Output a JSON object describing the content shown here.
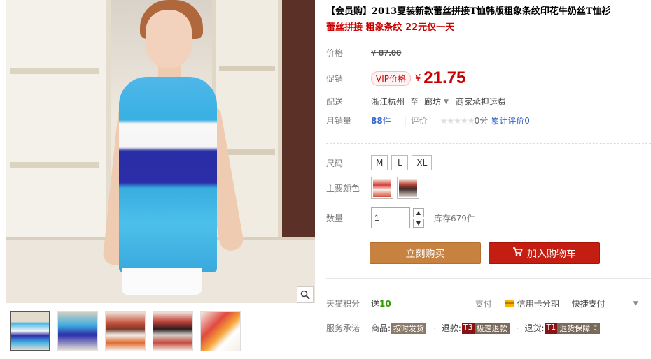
{
  "product": {
    "title": "【会员购】2013夏装新款蕾丝拼接T恤韩版粗象条纹印花牛奶丝T恤衫",
    "subtitle": "蕾丝拼接 粗象条纹 22元仅一天"
  },
  "price": {
    "label": "价格",
    "currency": "¥",
    "original": "87.00"
  },
  "promo": {
    "label": "促销",
    "tag": "VIP价格",
    "currency": "¥",
    "price": "21.75"
  },
  "delivery": {
    "label": "配送",
    "from": "浙江杭州",
    "to_word": "至",
    "destination": "廊坊",
    "note": "商家承担运费"
  },
  "sales": {
    "label": "月销量",
    "count": "88",
    "unit": "件",
    "separator": "|",
    "rating_label": "评价",
    "stars": "★★★★★",
    "score": "0分",
    "review_link": "累计评价0"
  },
  "sku": {
    "size_label": "尺码",
    "sizes": [
      "M",
      "L",
      "XL"
    ],
    "color_label": "主要颜色",
    "quantity_label": "数量",
    "quantity": "1",
    "stock": "库存679件"
  },
  "actions": {
    "buy_now": "立刻购买",
    "add_cart": "加入购物车"
  },
  "points": {
    "label": "天猫积分",
    "send": "送",
    "value": "10"
  },
  "payment": {
    "label": "支付",
    "option1": "信用卡分期",
    "option2": "快捷支付"
  },
  "service": {
    "label": "服务承诺",
    "goods_label": "商品:",
    "goods_badge": "按时发货",
    "refund_label": "退款:",
    "refund_code": "T3",
    "refund_badge": "极速退款",
    "return_label": "退货:",
    "return_code": "T1",
    "return_badge": "退货保障卡",
    "dot": "·"
  },
  "icons": {
    "zoom": "magnifier-icon",
    "cart": "cart-icon",
    "card": "credit-card-icon",
    "arrow": "chevron-down-icon"
  },
  "colors": {
    "accent_red": "#c41d12",
    "buy_orange": "#c8823f",
    "link_blue": "#3366cc"
  }
}
